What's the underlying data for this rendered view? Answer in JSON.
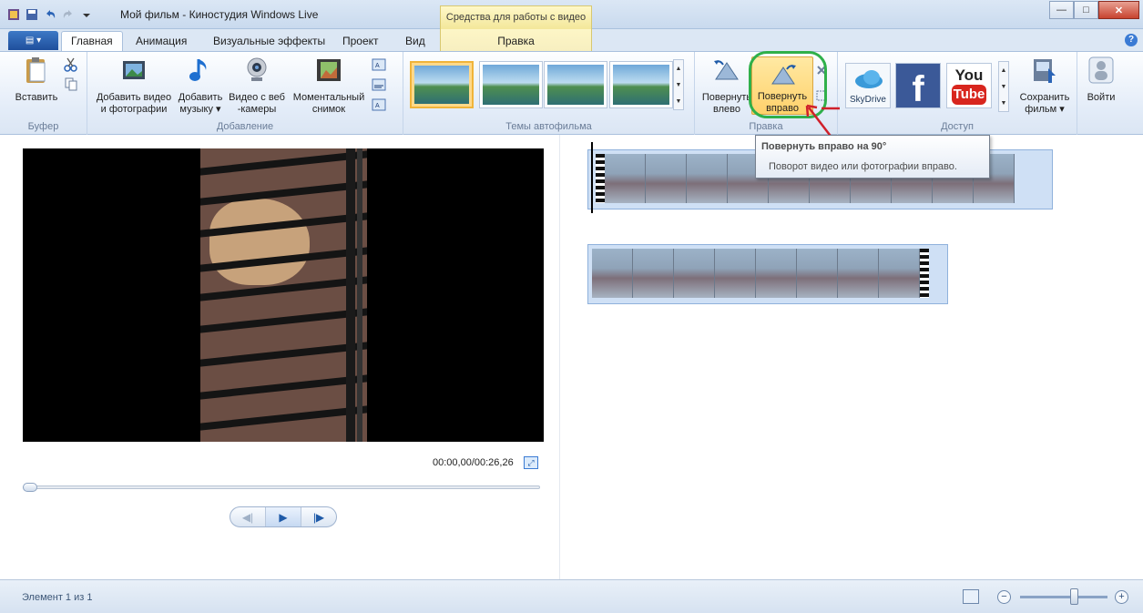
{
  "window": {
    "title": "Мой фильм - Киностудия Windows Live",
    "context_group_header": "Средства для работы с видео",
    "buttons": {
      "minimize": "—",
      "maximize": "□",
      "close": "✕"
    }
  },
  "tabs": {
    "file": "▤ ▾",
    "items": [
      "Главная",
      "Анимация",
      "Визуальные эффекты",
      "Проект",
      "Вид"
    ],
    "context": "Правка",
    "active": "Главная"
  },
  "ribbon": {
    "clipboard": {
      "label": "Буфер",
      "paste": "Вставить"
    },
    "add": {
      "label": "Добавление",
      "add_video_l1": "Добавить видео",
      "add_video_l2": "и фотографии",
      "add_music_l1": "Добавить",
      "add_music_l2": "музыку ▾",
      "webcam_l1": "Видео с веб",
      "webcam_l2": "-камеры",
      "snapshot_l1": "Моментальный",
      "snapshot_l2": "снимок"
    },
    "themes": {
      "label": "Темы автофильма"
    },
    "edit": {
      "label": "Правка",
      "rotate_left_l1": "Повернуть",
      "rotate_left_l2": "влево",
      "rotate_right_l1": "Повернуть",
      "rotate_right_l2": "вправо"
    },
    "share": {
      "label": "Доступ",
      "skydrive": "SkyDrive",
      "facebook": "f",
      "youtube_you": "You",
      "youtube_tube": "Tube",
      "save_l1": "Сохранить",
      "save_l2": "фильм ▾"
    },
    "signin": "Войти"
  },
  "tooltip": {
    "title": "Повернуть вправо на 90°",
    "description": "Поворот видео или фотографии вправо."
  },
  "preview": {
    "timecode": "00:00,00/00:26,26",
    "progress": 0
  },
  "status": {
    "text": "Элемент 1 из 1"
  },
  "colors": {
    "accent": "#3b7bd4",
    "highlight_circle": "#2fb04a",
    "annotation_arrow": "#d0202a",
    "selected_button": "#ffd16b"
  },
  "icons": [
    "paste-icon",
    "cut-icon",
    "copy-icon",
    "add-video-icon",
    "music-icon",
    "webcam-icon",
    "snapshot-icon",
    "rotate-left-icon",
    "rotate-right-icon",
    "skydrive-icon",
    "facebook-icon",
    "youtube-icon",
    "save-movie-icon",
    "signin-icon",
    "help-icon"
  ]
}
